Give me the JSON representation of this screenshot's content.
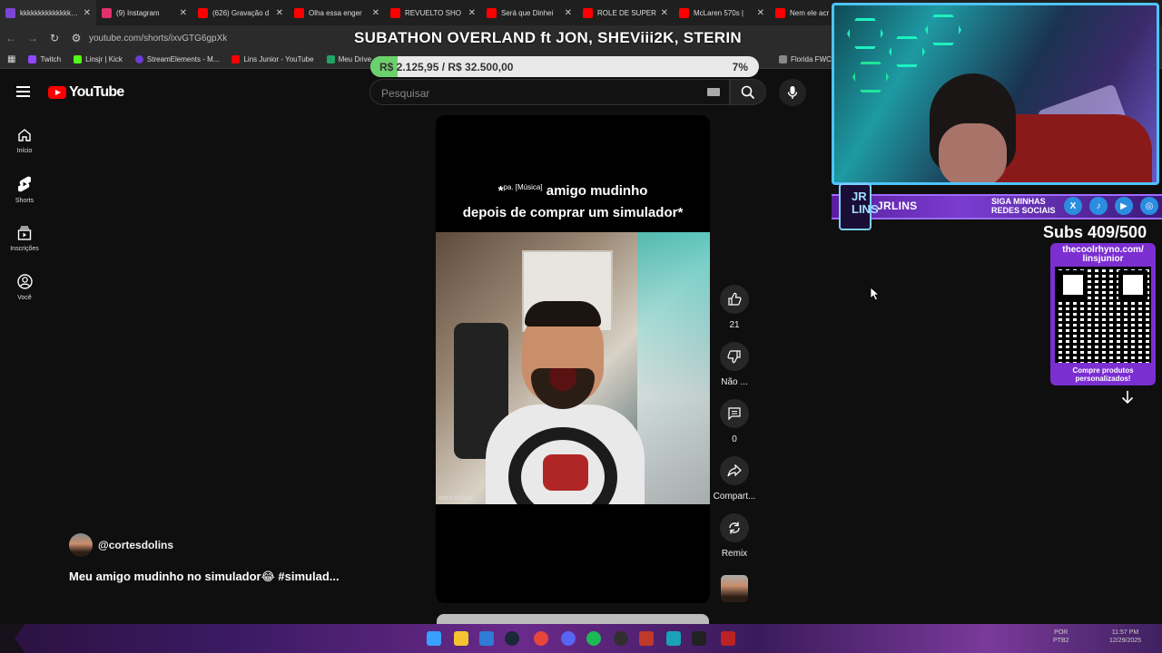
{
  "browser": {
    "tabs": [
      {
        "label": "kkkkkkkkkkkkkkkkk",
        "color": "#7b46d8"
      },
      {
        "label": "(9) Instagram",
        "color": "#e1306c"
      },
      {
        "label": "(626) Gravação d",
        "color": "#ff0000"
      },
      {
        "label": "Olha essa enger",
        "color": "#ff0000"
      },
      {
        "label": "REVUELTO SHO",
        "color": "#ff0000"
      },
      {
        "label": "Será que Dinhei",
        "color": "#ff0000"
      },
      {
        "label": "ROLE DE SUPER",
        "color": "#ff0000"
      },
      {
        "label": "McLaren 570s |",
        "color": "#ff0000"
      },
      {
        "label": "Nem ele acr",
        "color": "#ff0000"
      }
    ],
    "url": "youtube.com/shorts/ixvGTG6gpXk",
    "bookmarks": [
      {
        "label": "Twitch",
        "color": "#9146ff"
      },
      {
        "label": "Linsjr | Kick",
        "color": "#53fc18"
      },
      {
        "label": "StreamElements - M...",
        "color": "#6b3dd6"
      },
      {
        "label": "Lins Junior - YouTube",
        "color": "#ff0000"
      },
      {
        "label": "Meu Drive",
        "color": "#1fa463"
      }
    ],
    "bookmark_right": "Florida FWC"
  },
  "overlay": {
    "stream_title": "SUBATHON OVERLAND ft JON, SHEViii2K, STERIN",
    "goal_text": "R$ 2.125,95 / R$ 32.500,00",
    "goal_percent_label": "7%",
    "goal_fraction": 0.07,
    "streamer_name": "JRLINS",
    "logo_text": "JR LINS",
    "follow_text_1": "SIGA MINHAS",
    "follow_text_2": "REDES SOCIAIS",
    "subs_text": "Subs 409/500",
    "qr_url_1": "thecoolrhyno.com/",
    "qr_url_2": "linsjunior",
    "qr_bottom_1": "Compre produtos",
    "qr_bottom_2": "personalizados!"
  },
  "youtube": {
    "brand": "YouTube",
    "search_placeholder": "Pesquisar",
    "nav": [
      {
        "label": "Início",
        "icon": "home-icon"
      },
      {
        "label": "Shorts",
        "icon": "shorts-icon"
      },
      {
        "label": "Inscrições",
        "icon": "subscriptions-icon"
      },
      {
        "label": "Você",
        "icon": "you-icon"
      }
    ],
    "short": {
      "caption_small_1": "pa.",
      "caption_small_2": "[Música]",
      "caption_line1_prefix": "*",
      "caption_line1": "amigo mudinho",
      "caption_line2": "depois de comprar um simulador*",
      "watermark": "witch.tv/linsjr",
      "channel_handle": "@cortesdolins",
      "title": "Meu amigo mudinho no simulador😂 #simulad..."
    },
    "actions": {
      "like_count": "21",
      "dislike_label": "Não ...",
      "comment_count": "0",
      "share_label": "Compart...",
      "remix_label": "Remix"
    }
  },
  "taskbar": {
    "lang_1": "POR",
    "lang_2": "PTB2",
    "time": "11:57 PM",
    "date": "12/29/2025"
  }
}
